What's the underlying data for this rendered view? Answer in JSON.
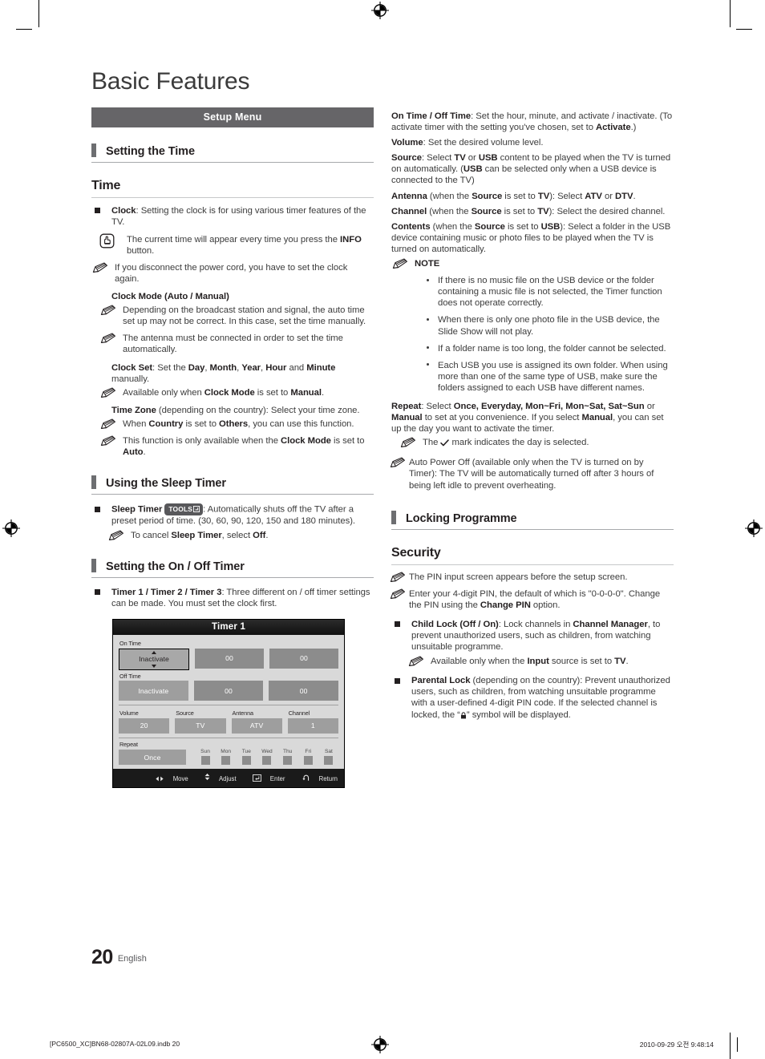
{
  "document": {
    "title": "Basic Features",
    "setup_menu_bar": "Setup Menu",
    "page_number": "20",
    "language": "English"
  },
  "footer": {
    "file_ref": "[PC6500_XC]BN68-02807A-02L09.indb   20",
    "timestamp": "2010-09-29   오전 9:48:14"
  },
  "left_column": {
    "section_heading": "Setting the Time",
    "subsection_heading": "Time",
    "clock_label": "Clock",
    "clock_text": ": Setting the clock is for using various timer features of the TV.",
    "info_note": "The current time will appear every time you press the INFO button.",
    "note_power_cord": "If you disconnect the power cord, you have to set the clock again.",
    "clock_mode_heading": "Clock Mode (Auto / Manual)",
    "note_broadcast": "Depending on the broadcast station and signal, the auto time set up may not be correct. In this case, set the time manually.",
    "note_antenna": "The antenna must be connected in order to set the time automatically.",
    "clock_set_label": "Clock Set",
    "note_clock_mode_manual": "Available only when Clock Mode is set to Manual.",
    "time_zone_label": "Time Zone",
    "note_country_others": "When Country is set to Others, you can use this function.",
    "note_clock_mode_auto": "This function is only available when the Clock Mode is set to Auto.",
    "sleep_timer_heading": "Using the Sleep Timer",
    "sleep_timer_label": "Sleep Timer",
    "tools_badge": "TOOLS",
    "sleep_timer_text": ": Automatically shuts off the TV after a preset period of time. (30, 60, 90, 120, 150 and 180 minutes).",
    "note_cancel_sleep": "To cancel Sleep Timer, select Off.",
    "onoff_timer_heading": "Setting the On / Off Timer",
    "timer_label": "Timer 1 / Timer 2 / Timer 3",
    "timer_text": ": Three different on / off timer settings can be made. You must set the clock first."
  },
  "osd": {
    "title": "Timer 1",
    "on_time_label": "On Time",
    "off_time_label": "Off Time",
    "on_time_state": "Inactivate",
    "on_time_hour": "00",
    "on_time_minute": "00",
    "off_time_state": "Inactivate",
    "off_time_hour": "00",
    "off_time_minute": "00",
    "volume_label": "Volume",
    "volume_value": "20",
    "source_label": "Source",
    "source_value": "TV",
    "antenna_label": "Antenna",
    "antenna_value": "ATV",
    "channel_label": "Channel",
    "channel_value": "1",
    "repeat_label": "Repeat",
    "repeat_value": "Once",
    "days": [
      "Sun",
      "Mon",
      "Tue",
      "Wed",
      "Thu",
      "Fri",
      "Sat"
    ],
    "footer_move": "Move",
    "footer_adjust": "Adjust",
    "footer_enter": "Enter",
    "footer_return": "Return"
  },
  "right_column": {
    "on_off_time_label": "On Time / Off Time",
    "on_off_time_text": ": Set the hour, minute, and activate / inactivate. (To activate timer with the setting you've chosen, set to Activate.)",
    "volume_label": "Volume",
    "volume_text": ": Set the desired volume level.",
    "source_label": "Source",
    "source_text": ": Select TV or USB content to be played when the TV is turned on automatically. (USB can be selected only when a USB device is connected to the TV)",
    "antenna_label": "Antenna",
    "antenna_text": " (when the Source is set to TV): Select ATV or DTV.",
    "channel_label": "Channel",
    "channel_text": " (when the Source is set to TV): Select the desired channel.",
    "contents_label": "Contents",
    "contents_text": " (when the Source is set to USB): Select a folder in the USB device containing music or photo files to be played when the TV is turned on automatically.",
    "note_heading": "NOTE",
    "note_bullets": [
      "If there is no music file on the USB device or the folder containing a music file is not selected, the Timer function does not operate correctly.",
      "When there is only one photo file in the USB device, the Slide Show will not play.",
      "If a folder name is too long, the folder cannot be selected.",
      "Each USB you use is assigned its own folder. When using more than one of the same type of USB, make sure the folders assigned to each USB have different names."
    ],
    "repeat_label": "Repeat",
    "repeat_text": ": Select Once, Everyday, Mon~Fri, Mon~Sat, Sat~Sun or Manual to set at you convenience. If you select Manual, you can set up the day you want to activate the timer.",
    "note_checkmark": "The ✓ mark indicates the day is selected.",
    "note_auto_power_off": "Auto Power Off (available only when the TV is turned on by Timer): The TV will be automatically turned off after 3 hours of being left idle to prevent overheating.",
    "locking_heading": "Locking Programme",
    "security_heading": "Security",
    "note_pin_screen": "The PIN input screen appears before the setup screen.",
    "note_pin_default": "Enter your 4-digit PIN, the default of which is \"0-0-0-0\". Change the PIN using the Change PIN option.",
    "child_lock_label": "Child Lock (Off / On)",
    "child_lock_text": ": Lock channels in Channel Manager, to prevent unauthorized users, such as children, from watching unsuitable programme.",
    "note_input_tv": "Available only when the Input source is set to TV.",
    "parental_lock_label": "Parental Lock",
    "parental_lock_text": " (depending on the country): Prevent unauthorized users, such as children, from watching unsuitable programme with a user-defined 4-digit PIN code. If the selected channel is locked, the “ ” symbol will be displayed."
  }
}
